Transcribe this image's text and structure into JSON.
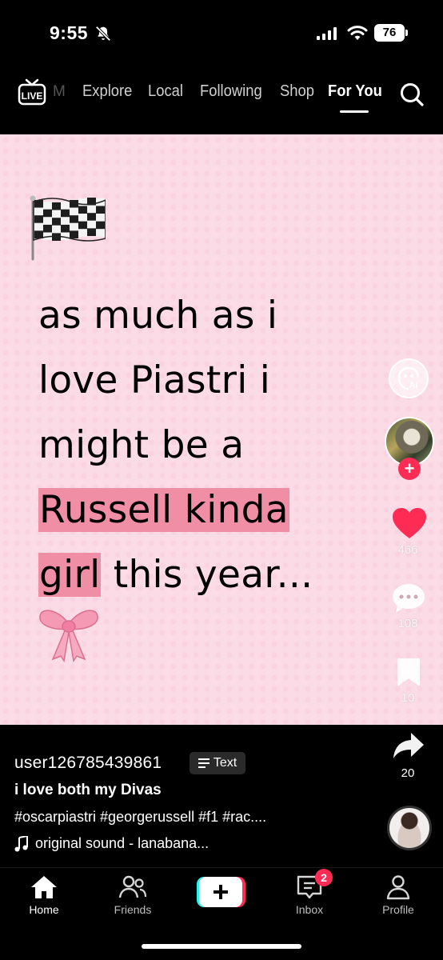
{
  "status_bar": {
    "time": "9:55",
    "battery": "76",
    "icons": [
      "bell-muted-icon",
      "signal-icon",
      "wifi-icon",
      "battery-icon"
    ]
  },
  "top_nav": {
    "live_label": "LIVE",
    "ghost_tab": "M",
    "tabs": [
      {
        "label": "Explore",
        "active": false
      },
      {
        "label": "Local",
        "active": false
      },
      {
        "label": "Following",
        "active": false
      },
      {
        "label": "Shop",
        "active": false
      },
      {
        "label": "For You",
        "active": true
      }
    ],
    "search_icon": "search-icon"
  },
  "video": {
    "background": "#fbdbe6",
    "highlight_color": "#f08ea6",
    "lines": [
      {
        "plain": "as much as i"
      },
      {
        "plain": "love Piastri i"
      },
      {
        "plain": "might be a"
      },
      {
        "highlight": "Russell kinda"
      },
      {
        "highlight": "girl",
        "plain": " this year..."
      }
    ],
    "emojis": [
      "checkered-flag",
      "pink-bow"
    ]
  },
  "rail": {
    "ai_icon": "ai-face-icon",
    "likes": "466",
    "comments": "108",
    "saves": "10",
    "shares": "20",
    "like_color": "#fe2c55"
  },
  "post": {
    "username": "user126785439861",
    "chip": "Text",
    "description": "i love both my Divas",
    "hashtags": "#oscarpiastri #georgerussell #f1 #rac....",
    "sound": "original sound - lanabana..."
  },
  "bottom_nav": {
    "items": [
      {
        "label": "Home",
        "active": true
      },
      {
        "label": "Friends",
        "active": false
      },
      {
        "label": "Inbox",
        "active": false
      },
      {
        "label": "Profile",
        "active": false
      }
    ],
    "inbox_badge": "2"
  }
}
